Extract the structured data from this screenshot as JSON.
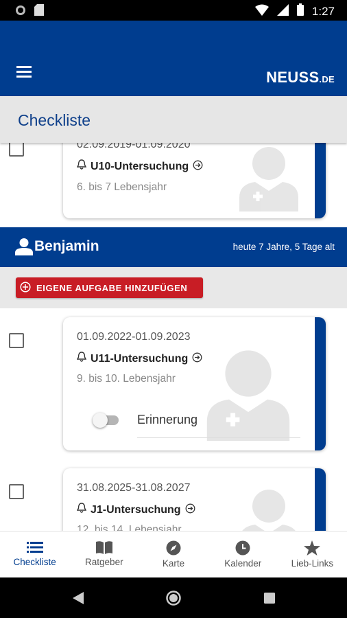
{
  "status_bar": {
    "time": "1:27"
  },
  "header": {
    "logo_main": "NEUSS",
    "logo_suffix": ".DE",
    "page_title": "Checkliste"
  },
  "top_card": {
    "date_range": "02.09.2019-01.09.2020",
    "exam": "U10-Untersuchung",
    "age_range": "6. bis 7 Lebensjahr"
  },
  "person": {
    "name": "Benjamin",
    "age_text": "heute 7 Jahre, 5 Tage alt"
  },
  "add_task_button": "EIGENE AUFGABE HINZUFÜGEN",
  "cards": [
    {
      "date_range": "01.09.2022-01.09.2023",
      "exam": "U11-Untersuchung",
      "age_range": "9. bis 10. Lebensjahr",
      "reminder_label": "Erinnerung",
      "reminder_on": false
    },
    {
      "date_range": "31.08.2025-31.08.2027",
      "exam": "J1-Untersuchung",
      "age_range": "12. bis 14. Lebensjahr"
    }
  ],
  "bottom_nav": [
    {
      "label": "Checkliste",
      "icon": "list-icon",
      "active": true
    },
    {
      "label": "Ratgeber",
      "icon": "book-icon",
      "active": false
    },
    {
      "label": "Karte",
      "icon": "compass-icon",
      "active": false
    },
    {
      "label": "Kalender",
      "icon": "clock-icon",
      "active": false
    },
    {
      "label": "Lieb-Links",
      "icon": "star-icon",
      "active": false
    }
  ],
  "colors": {
    "brand_blue": "#003d8f",
    "button_red": "#c81d25",
    "title_blue": "#0e3f8a"
  }
}
